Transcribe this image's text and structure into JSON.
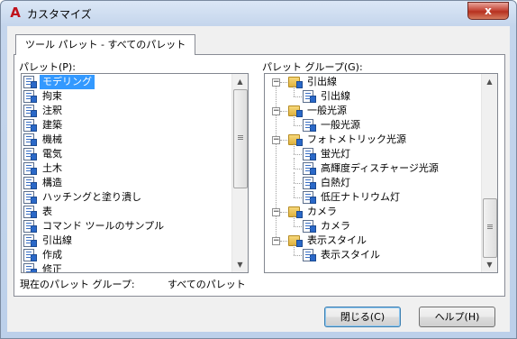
{
  "window": {
    "title": "カスタマイズ",
    "app_icon": "A",
    "close_glyph": "x"
  },
  "tab": {
    "label": "ツール パレット - すべてのパレット"
  },
  "palettes": {
    "label": "パレット(P):",
    "items": [
      {
        "label": "モデリング",
        "selected": true
      },
      {
        "label": "拘束"
      },
      {
        "label": "注釈"
      },
      {
        "label": "建築"
      },
      {
        "label": "機械"
      },
      {
        "label": "電気"
      },
      {
        "label": "土木"
      },
      {
        "label": "構造"
      },
      {
        "label": "ハッチングと塗り潰し"
      },
      {
        "label": "表"
      },
      {
        "label": "コマンド ツールのサンプル"
      },
      {
        "label": "引出線"
      },
      {
        "label": "作成"
      },
      {
        "label": "修正"
      }
    ]
  },
  "groups": {
    "label": "パレット グループ(G):",
    "items": [
      {
        "label": "引出線",
        "type": "folder"
      },
      {
        "label": "引出線",
        "type": "palette"
      },
      {
        "label": "一般光源",
        "type": "folder"
      },
      {
        "label": "一般光源",
        "type": "palette"
      },
      {
        "label": "フォトメトリック光源",
        "type": "folder"
      },
      {
        "label": "蛍光灯",
        "type": "palette"
      },
      {
        "label": "高輝度ディスチャージ光源",
        "type": "palette"
      },
      {
        "label": "白熱灯",
        "type": "palette"
      },
      {
        "label": "低圧ナトリウム灯",
        "type": "palette"
      },
      {
        "label": "カメラ",
        "type": "folder"
      },
      {
        "label": "カメラ",
        "type": "palette"
      },
      {
        "label": "表示スタイル",
        "type": "folder"
      },
      {
        "label": "表示スタイル",
        "type": "palette"
      }
    ]
  },
  "current_group": {
    "label": "現在のパレット グループ:",
    "value": "すべてのパレット"
  },
  "buttons": {
    "close": "閉じる(C)",
    "help": "ヘルプ(H)"
  },
  "colors": {
    "selection": "#3399ff",
    "title_bar": "#c4d5ec",
    "close_button": "#c6493a"
  }
}
